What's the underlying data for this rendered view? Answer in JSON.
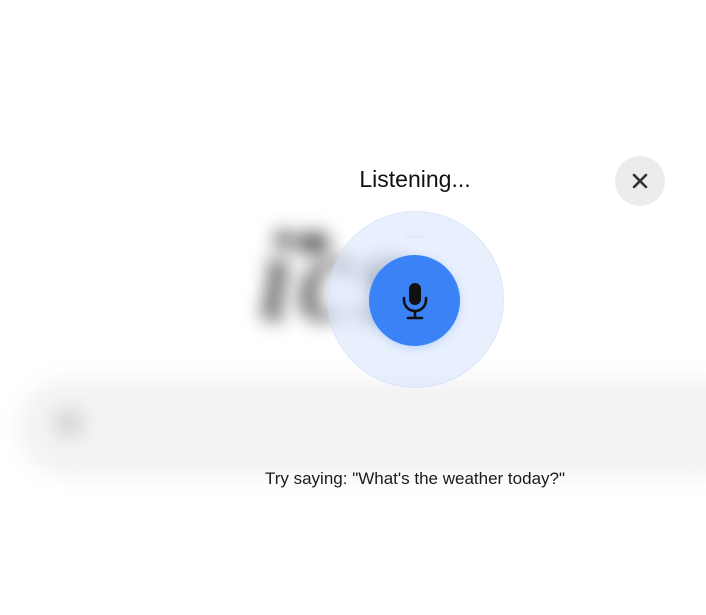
{
  "overlay": {
    "title": "Listening...",
    "hint": "Try saying: \"What's the weather today?\"",
    "close_icon": "close-icon",
    "mic_icon": "microphone-icon"
  },
  "colors": {
    "accent": "#3b82f6",
    "ring": "#d6e2fc",
    "close_bg": "#ececec",
    "text": "#111111"
  }
}
